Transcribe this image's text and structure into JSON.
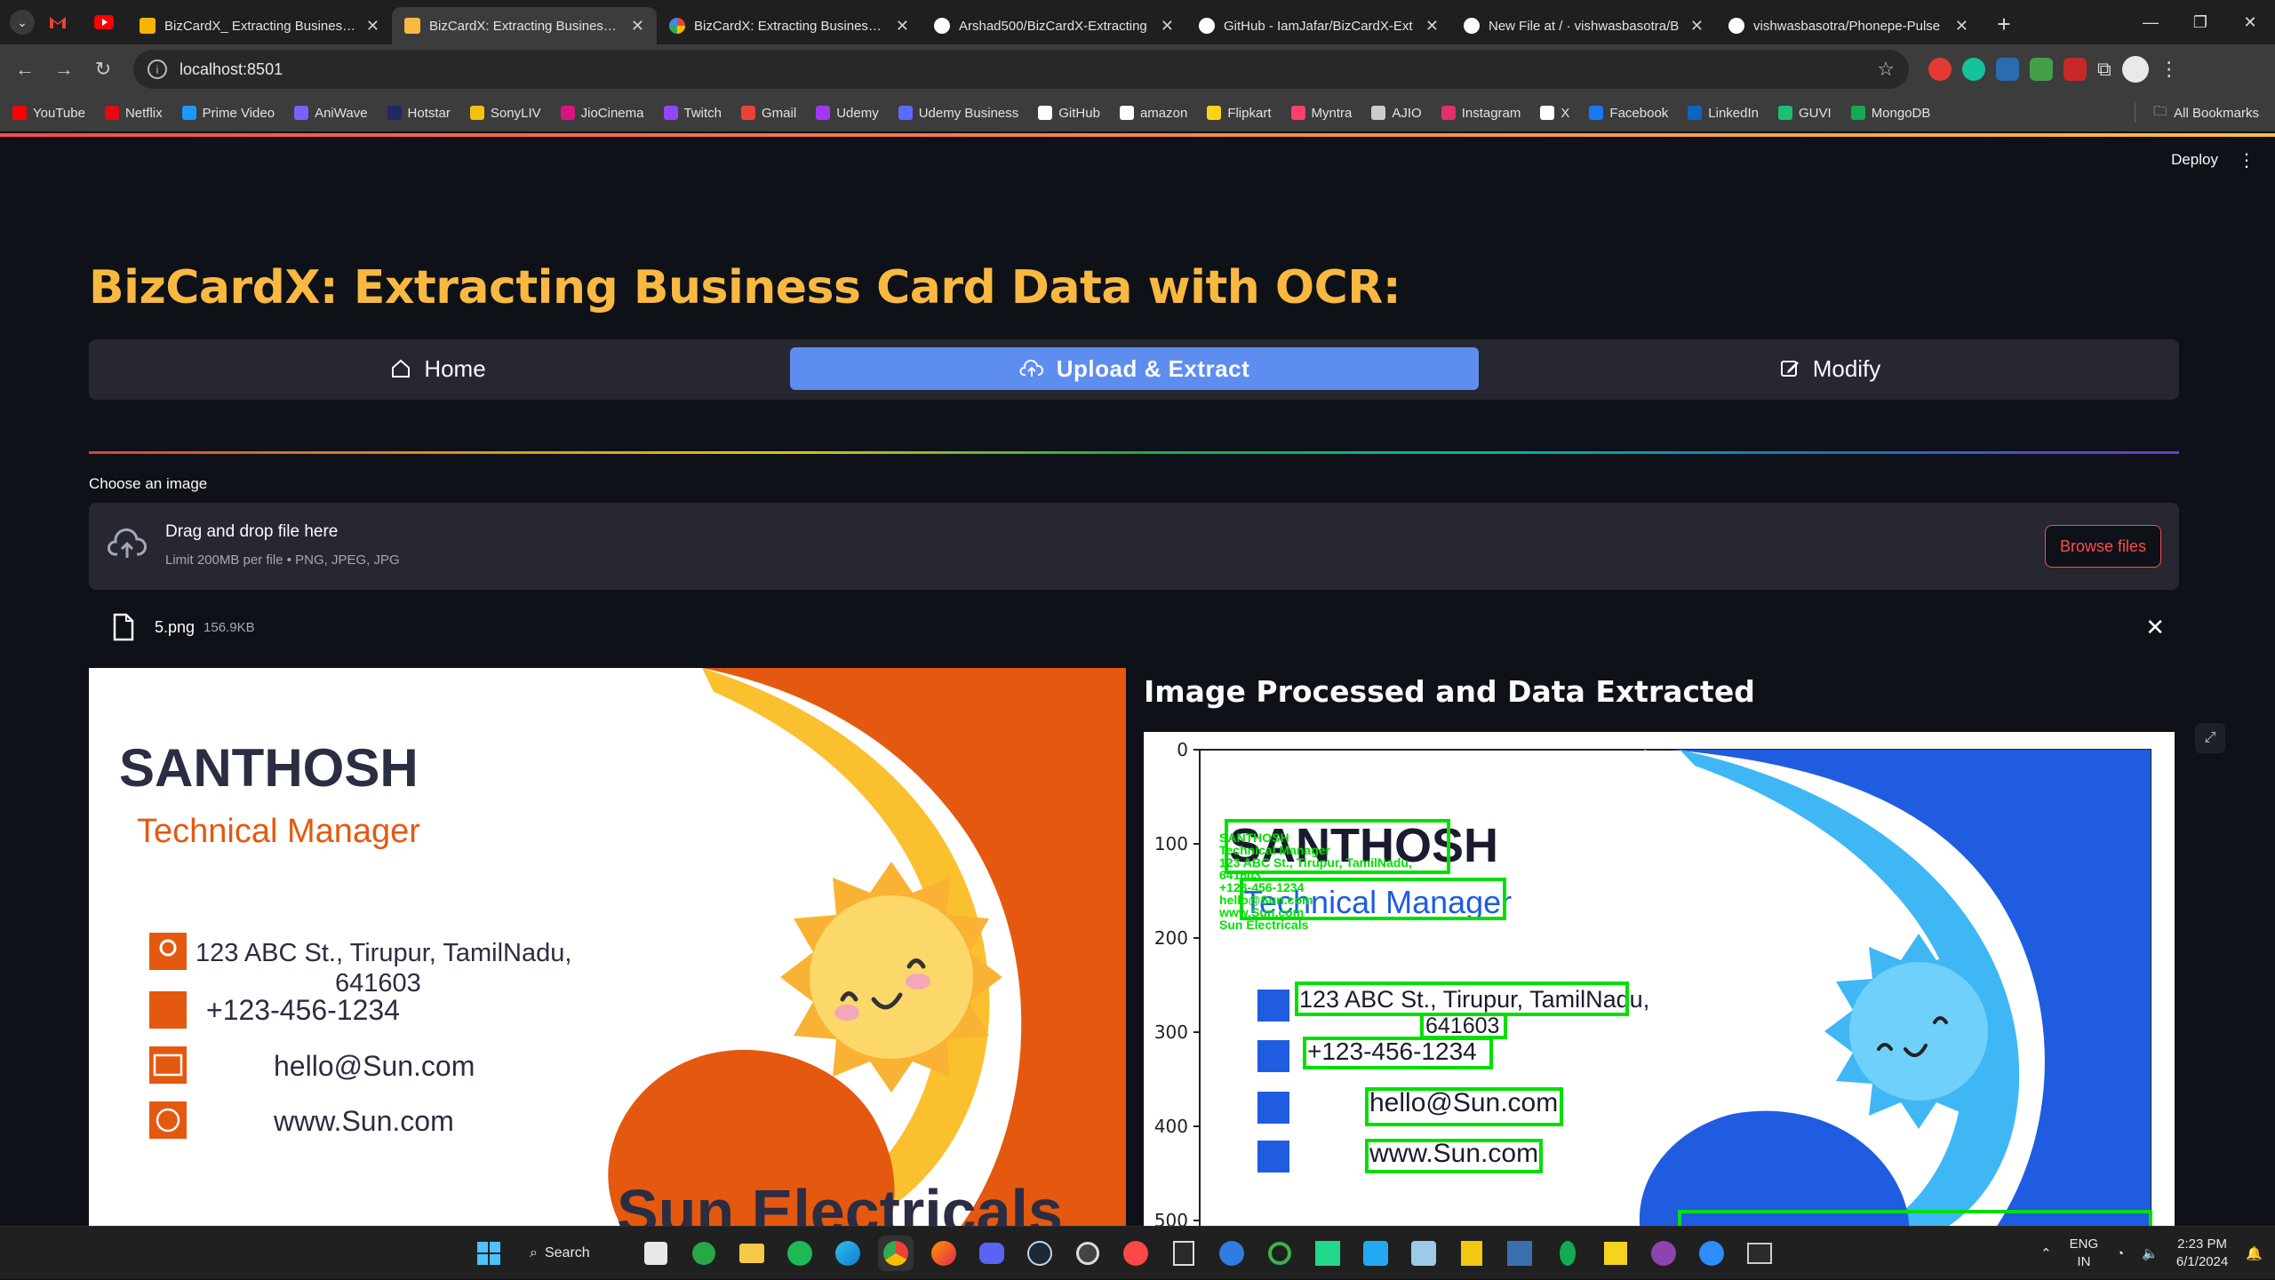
{
  "browser": {
    "tabs": [
      {
        "title": "BizCardX_ Extracting Business C",
        "favicon_color": "#f4b400",
        "active": false
      },
      {
        "title": "BizCardX: Extracting Business C",
        "favicon_color": "#f9b941",
        "active": true
      },
      {
        "title": "BizCardX: Extracting Business C",
        "favicon_color": "#ffffff",
        "active": false
      },
      {
        "title": "Arshad500/BizCardX-Extracting",
        "favicon_color": "#ffffff",
        "active": false
      },
      {
        "title": "GitHub - IamJafar/BizCardX-Ext",
        "favicon_color": "#ffffff",
        "active": false
      },
      {
        "title": "New File at / · vishwasbasotra/B",
        "favicon_color": "#ffffff",
        "active": false
      },
      {
        "title": "vishwasbasotra/Phonepe-Pulse",
        "favicon_color": "#ffffff",
        "active": false
      }
    ],
    "url": "localhost:8501",
    "bookmarks": [
      {
        "label": "YouTube",
        "color": "#ff0000"
      },
      {
        "label": "Netflix",
        "color": "#e50914"
      },
      {
        "label": "Prime Video",
        "color": "#1a98ff"
      },
      {
        "label": "AniWave",
        "color": "#7d5fff"
      },
      {
        "label": "Hotstar",
        "color": "#1f2a60"
      },
      {
        "label": "SonyLIV",
        "color": "#f4c20d"
      },
      {
        "label": "JioCinema",
        "color": "#d6157f"
      },
      {
        "label": "Twitch",
        "color": "#9146ff"
      },
      {
        "label": "Gmail",
        "color": "#ea4335"
      },
      {
        "label": "Udemy",
        "color": "#a435f0"
      },
      {
        "label": "Udemy Business",
        "color": "#5b6bff"
      },
      {
        "label": "GitHub",
        "color": "#ffffff"
      },
      {
        "label": "amazon",
        "color": "#ffffff"
      },
      {
        "label": "Flipkart",
        "color": "#f7d417"
      },
      {
        "label": "Myntra",
        "color": "#ff3f6c"
      },
      {
        "label": "AJIO",
        "color": "#cccccc"
      },
      {
        "label": "Instagram",
        "color": "#e1306c"
      },
      {
        "label": "X",
        "color": "#ffffff"
      },
      {
        "label": "Facebook",
        "color": "#1877f2"
      },
      {
        "label": "LinkedIn",
        "color": "#0a66c2"
      },
      {
        "label": "GUVI",
        "color": "#1dbf73"
      },
      {
        "label": "MongoDB",
        "color": "#13aa52"
      }
    ],
    "all_bookmarks": "All Bookmarks"
  },
  "app": {
    "deploy": "Deploy",
    "title": "BizCardX: Extracting Business Card Data with OCR:",
    "nav": {
      "home": "Home",
      "upload": "Upload & Extract",
      "modify": "Modify"
    },
    "uploader": {
      "label": "Choose an image",
      "drag_text": "Drag and drop file here",
      "limit_text": "Limit 200MB per file • PNG, JPEG, JPG",
      "browse": "Browse files",
      "file_name": "5.png",
      "file_size": "156.9KB"
    },
    "result_header": "Image Processed and Data Extracted"
  },
  "card": {
    "name": "SANTHOSH",
    "designation": "Technical Manager",
    "address_line1": "123 ABC St., Tirupur, TamilNadu,",
    "address_line2": "641603",
    "phone": "+123-456-1234",
    "email": "hello@Sun.com",
    "website": "www.Sun.com",
    "company": "Sun Electricals",
    "orange": "#e4590f",
    "yellow": "#fbc02d"
  },
  "plot": {
    "y_ticks": [
      "0",
      "100",
      "200",
      "300",
      "400",
      "500"
    ],
    "detected_lines": [
      "SANTHOSH",
      "Technical Manager",
      "123 ABC St., Tirupur, TamilNadu,",
      "641603",
      "+123-456-1234",
      "hello@Sun.com",
      "www.Sun.com",
      "Sun Electricals"
    ],
    "box_color": "#00e000",
    "blue": "#1f5ce0",
    "light_blue": "#3fb7f5"
  },
  "taskbar": {
    "search": "Search",
    "lang_top": "ENG",
    "lang_bottom": "IN",
    "time": "2:23 PM",
    "date": "6/1/2024"
  }
}
